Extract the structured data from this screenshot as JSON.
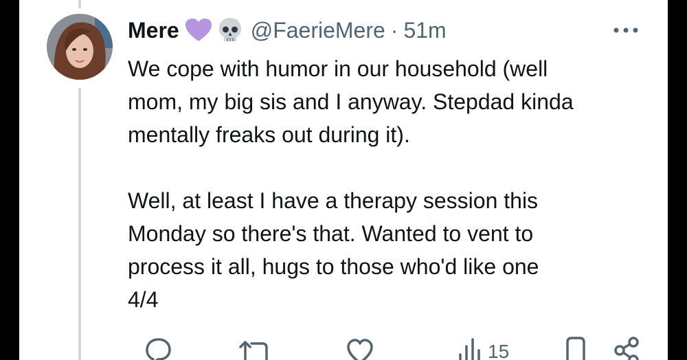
{
  "tweet": {
    "author_name": "Mere",
    "handle": "@FaerieMere",
    "separator": "·",
    "time": "51m",
    "emojis": [
      "purple-heart-icon",
      "skull-icon"
    ],
    "paragraphs": [
      "We cope with humor in our household (well\nmom, my big sis and I anyway. Stepdad kinda\nmentally freaks out during it).",
      "Well, at least I have a therapy session this\nMonday so there's that. Wanted to vent to\nprocess it all, hugs to those who'd like one\n4/4"
    ]
  },
  "actions": {
    "reply_icon": "reply-icon",
    "retweet_icon": "retweet-icon",
    "like_icon": "like-icon",
    "views_icon": "views-icon",
    "views_count": "15",
    "bookmark_icon": "bookmark-icon",
    "share_icon": "share-icon"
  },
  "colors": {
    "text": "#0f1419",
    "secondary": "#536471",
    "thread_line": "#cfd9de",
    "heart": "#b794e0",
    "background": "#ffffff"
  }
}
